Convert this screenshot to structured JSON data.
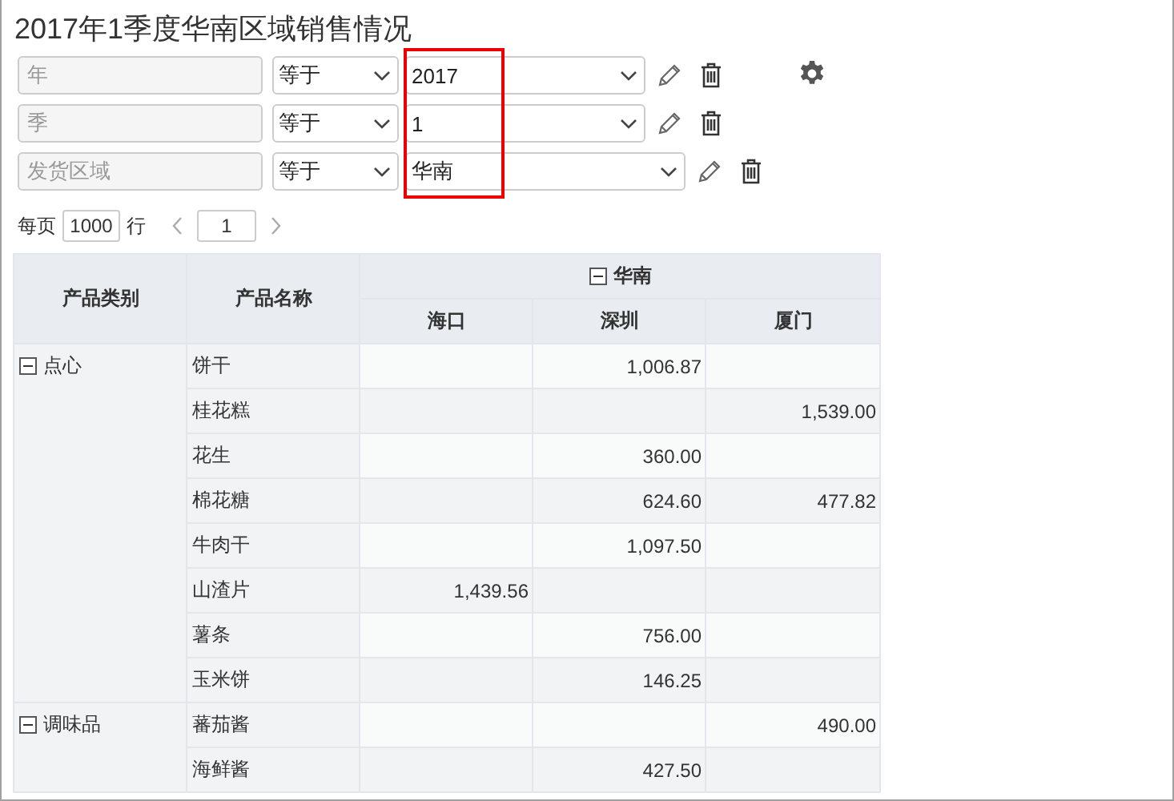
{
  "title": "2017年1季度华南区域销售情况",
  "filters": [
    {
      "field": "年",
      "operator": "等于",
      "value": "2017",
      "wide": false,
      "highlighted": true
    },
    {
      "field": "季",
      "operator": "等于",
      "value": "1",
      "wide": false,
      "highlighted": true
    },
    {
      "field": "发货区域",
      "operator": "等于",
      "value": "华南",
      "wide": true,
      "highlighted": true
    }
  ],
  "pagination": {
    "per_page_label": "每页",
    "per_page": "1000",
    "rows_label": "行",
    "page": "1"
  },
  "table": {
    "row_headers": [
      "产品类别",
      "产品名称"
    ],
    "group": {
      "label": "华南",
      "expanded": true
    },
    "columns": [
      "海口",
      "深圳",
      "厦门"
    ],
    "groups": [
      {
        "name": "点心",
        "expanded": true,
        "rows": [
          {
            "name": "饼干",
            "column_2": "1,006.87"
          },
          {
            "name": "桂花糕",
            "column_3": "1,539.00"
          },
          {
            "name": "花生",
            "column_2": "360.00"
          },
          {
            "name": "棉花糖",
            "column_2": "624.60",
            "column_3": "477.82"
          },
          {
            "name": "牛肉干",
            "column_2": "1,097.50"
          },
          {
            "name": "山渣片",
            "column_1": "1,439.56"
          },
          {
            "name": "薯条",
            "column_2": "756.00"
          },
          {
            "name": "玉米饼",
            "column_2": "146.25"
          }
        ]
      },
      {
        "name": "调味品",
        "expanded": true,
        "rows": [
          {
            "name": "蕃茄酱",
            "column_3": "490.00"
          },
          {
            "name": "海鲜酱",
            "column_2": "427.50"
          }
        ]
      }
    ]
  }
}
